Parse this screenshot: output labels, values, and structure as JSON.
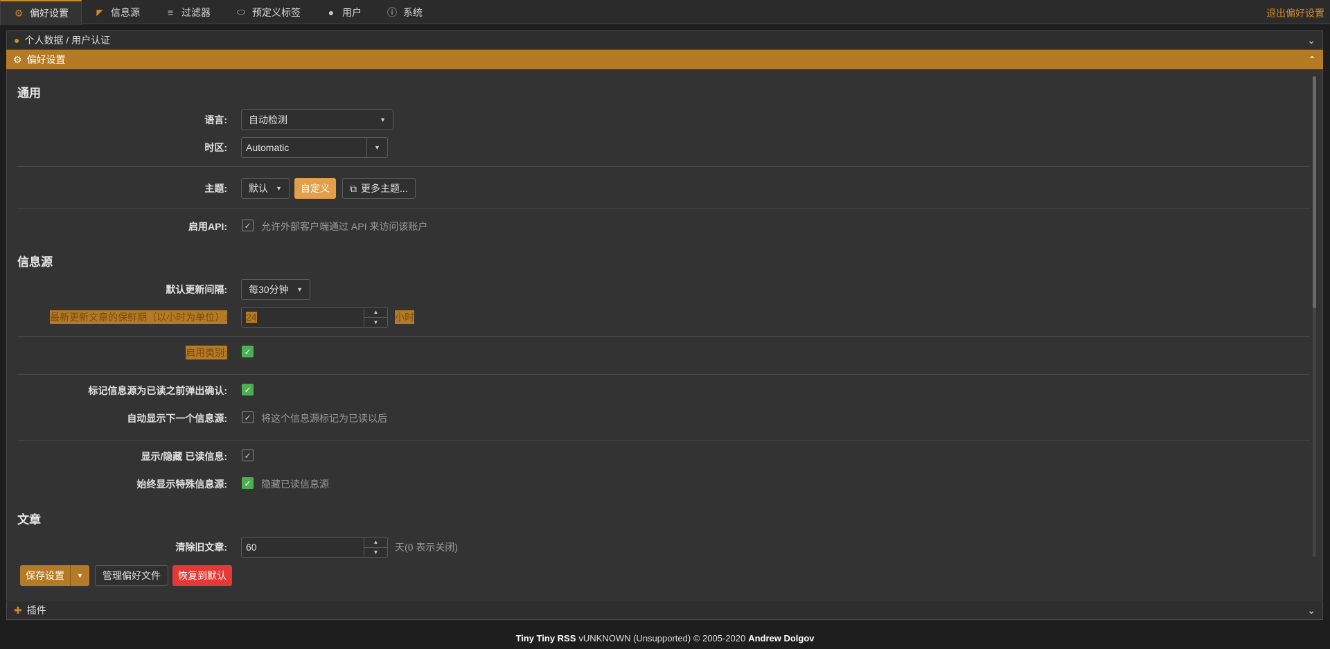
{
  "tabs": [
    {
      "label": "偏好设置",
      "icon": "gear-icon"
    },
    {
      "label": "信息源",
      "icon": "rss-icon"
    },
    {
      "label": "过滤器",
      "icon": "filter-icon"
    },
    {
      "label": "预定义标签",
      "icon": "label-icon"
    },
    {
      "label": "用户",
      "icon": "user-icon"
    },
    {
      "label": "系统",
      "icon": "info-icon"
    }
  ],
  "logout_label": "退出偏好设置",
  "panels": {
    "personal": "个人数据 / 用户认证",
    "prefs": "偏好设置",
    "plugins": "插件"
  },
  "general": {
    "title": "通用",
    "language_label": "语言:",
    "language_value": "自动检测",
    "timezone_label": "时区:",
    "timezone_value": "Automatic",
    "theme_label": "主题:",
    "theme_value": "默认",
    "customize_label": "自定义",
    "more_themes_label": "更多主题...",
    "api_label": "启用API:",
    "api_hint": "允许外部客户端通过 API 来访问该账户"
  },
  "feeds": {
    "title": "信息源",
    "interval_label": "默认更新间隔:",
    "interval_value": "每30分钟",
    "fresh_label": "最新更新文章的保鲜期（以小时为单位）:",
    "fresh_value": "24",
    "fresh_unit": "小时",
    "categories_label": "启用类别:",
    "confirm_label": "标记信息源为已读之前弹出确认:",
    "next_feed_label": "自动显示下一个信息源:",
    "next_feed_hint": "将这个信息源标记为已读以后",
    "show_read_label": "显示/隐藏 已读信息:",
    "special_label": "始终显示特殊信息源:",
    "special_hint": "隐藏已读信息源"
  },
  "articles": {
    "title": "文章",
    "purge_label": "清除旧文章:",
    "purge_value": "60",
    "purge_hint": "天(0 表示关闭)"
  },
  "actions": {
    "save": "保存设置",
    "manage": "管理偏好文件",
    "reset": "恢复到默认"
  },
  "footer": {
    "app": "Tiny Tiny RSS",
    "version": "vUNKNOWN (Unsupported) © 2005-2020",
    "author": "Andrew Dolgov"
  },
  "checkboxes": {
    "api": false,
    "categories": true,
    "confirm": true,
    "next_feed": false,
    "show_read": false,
    "special": true
  }
}
